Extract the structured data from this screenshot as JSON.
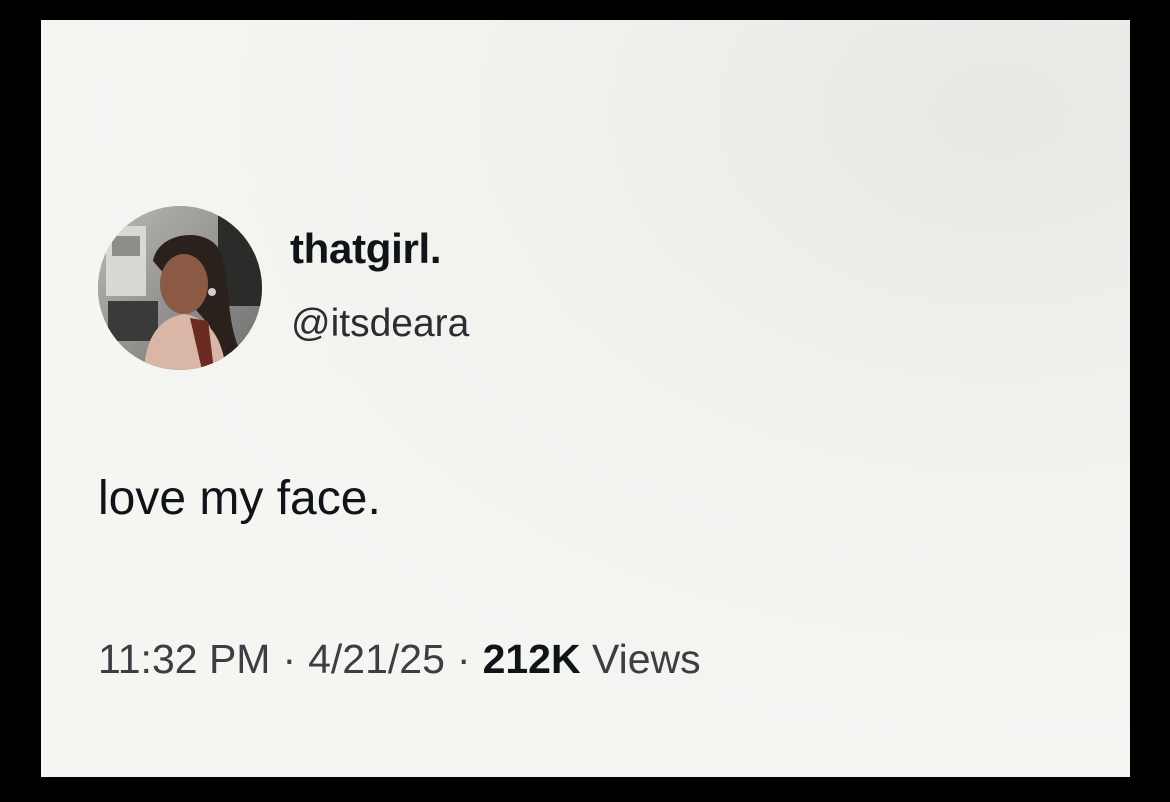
{
  "tweet": {
    "display_name": "thatgirl.",
    "handle": "@itsdeara",
    "text": "love my face.",
    "time": "11:32 PM",
    "date": "4/21/25",
    "views_count": "212K",
    "views_label": "Views",
    "separator": "·"
  },
  "avatar": {
    "icon": "profile-photo"
  },
  "colors": {
    "background": "#000000",
    "card": "#f5f5f2",
    "primary_text": "#0f1419",
    "secondary_text": "#3b3f44"
  }
}
